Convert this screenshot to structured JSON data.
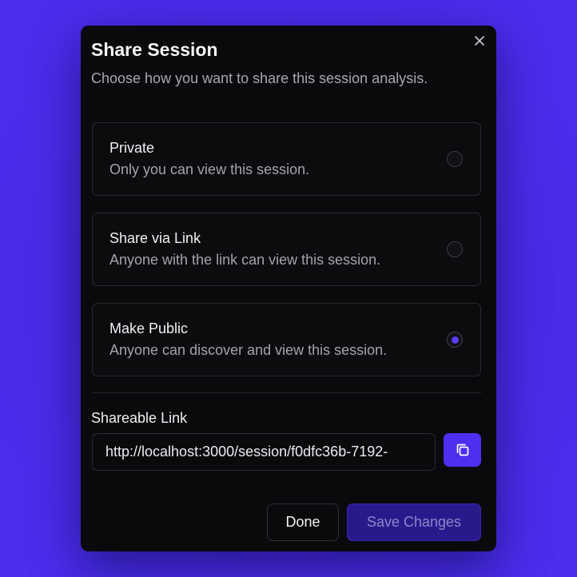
{
  "dialog": {
    "title": "Share Session",
    "subtitle": "Choose how you want to share this session analysis.",
    "close_icon": "close-icon"
  },
  "options": [
    {
      "id": "private",
      "title": "Private",
      "description": "Only you can view this session.",
      "selected": false
    },
    {
      "id": "link",
      "title": "Share via Link",
      "description": "Anyone with the link can view this session.",
      "selected": false
    },
    {
      "id": "public",
      "title": "Make Public",
      "description": "Anyone can discover and view this session.",
      "selected": true
    }
  ],
  "shareable_link": {
    "label": "Shareable Link",
    "value": "http://localhost:3000/session/f0dfc36b-7192-",
    "copy_icon": "copy-icon"
  },
  "footer": {
    "done_label": "Done",
    "save_label": "Save Changes"
  },
  "colors": {
    "accent": "#4f2ef2",
    "background": "#4b2ef0",
    "dialog": "#0a0a0c"
  }
}
